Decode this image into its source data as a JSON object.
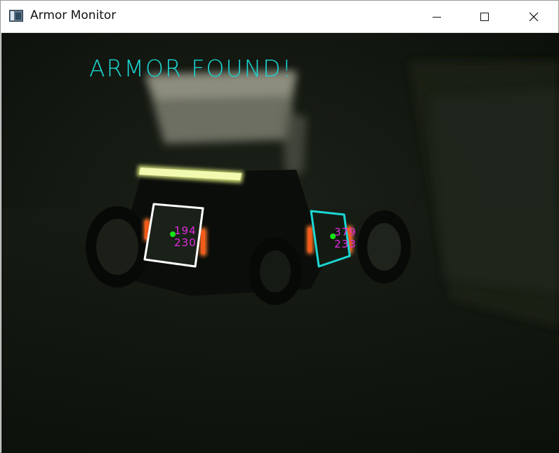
{
  "window": {
    "title": "Armor Monitor",
    "controls": {
      "minimize": "minimize-icon",
      "maximize": "maximize-icon",
      "close": "close-icon"
    }
  },
  "overlay": {
    "status_text": "ARMOR FOUND!",
    "status_color": "#1bd6d2",
    "label_color": "#e12be0",
    "center_color": "#16e616"
  },
  "targets": [
    {
      "box_color": "#ffffff",
      "x_label": "194",
      "y_label": "230"
    },
    {
      "box_color": "#1bd6d2",
      "x_label": "379",
      "y_label": "233"
    }
  ]
}
